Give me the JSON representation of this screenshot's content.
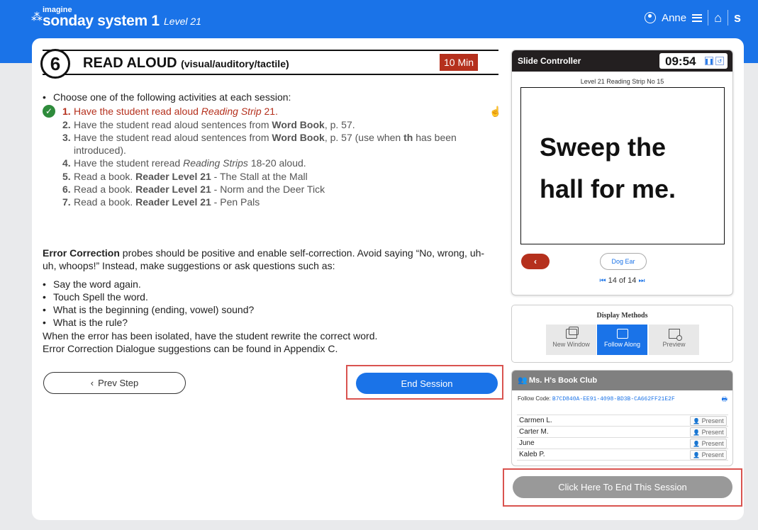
{
  "brand": {
    "imagine": "imagine",
    "name": "sonday system 1",
    "level": "Level 21"
  },
  "header": {
    "user_name": "Anne",
    "s_label": "s"
  },
  "step": {
    "number": "6",
    "title": "READ ALOUD",
    "subtitle": "(visual/auditory/tactile)",
    "duration": "10 Min"
  },
  "instructions": {
    "intro": "Choose one of the following activities at each session:",
    "activities": [
      {
        "num": "1.",
        "html": "Have the student read aloud <i>Reading Strip</i> 21.",
        "active": true
      },
      {
        "num": "2.",
        "html": "Have the student read aloud sentences from <b>Word Book</b>, p. 57.",
        "active": false
      },
      {
        "num": "3.",
        "html": "Have the student read aloud sentences from <b>Word Book</b>, p. 57 (use when <b>th</b> has been introduced).",
        "active": false
      },
      {
        "num": "4.",
        "html": "Have the student reread <i>Reading Strips</i> 18-20 aloud.",
        "active": false
      },
      {
        "num": "5.",
        "html": "Read a book. <b>Reader Level 21</b> - The Stall at the Mall",
        "active": false
      },
      {
        "num": "6.",
        "html": "Read a book. <b>Reader Level 21</b> - Norm and the Deer Tick",
        "active": false
      },
      {
        "num": "7.",
        "html": "Read a book. <b>Reader Level 21</b> - Pen Pals",
        "active": false
      }
    ]
  },
  "error_correction": {
    "lead": "Error Correction",
    "text": " probes should be positive and enable self-correction. Avoid saying “No, wrong, uh-uh, whoops!” Instead, make suggestions or ask questions such as:",
    "suggestions": [
      "Say the word again.",
      "Touch Spell the word.",
      "What is the beginning (ending, vowel) sound?",
      "What is the rule?"
    ],
    "footer1": "When the error has been isolated, have the student rewrite the correct word.",
    "footer2": "Error Correction Dialogue suggestions can be found in Appendix C."
  },
  "buttons": {
    "prev": "Prev Step",
    "end": "End Session",
    "end_this": "Click Here To End This Session"
  },
  "slide_controller": {
    "title": "Slide Controller",
    "timer": "09:54",
    "label": "Level 21 Reading Strip No 15",
    "line1": "Sweep the",
    "line2": "hall for me.",
    "dog_ear": "Dog Ear",
    "pager": "14 of 14"
  },
  "display_methods": {
    "title": "Display Methods",
    "items": [
      {
        "label": "New Window",
        "icon": "new-window-icon",
        "active": false
      },
      {
        "label": "Follow Along",
        "icon": "cast-icon",
        "active": true
      },
      {
        "label": "Preview",
        "icon": "preview-icon",
        "active": false
      }
    ]
  },
  "book_club": {
    "title": "Ms. H's Book Club",
    "follow_label": "Follow Code:",
    "follow_code": "B7CD840A-EE91-4098-BD3B-CA662FF21E2F",
    "students": [
      {
        "name": "Carmen L.",
        "status": "Present"
      },
      {
        "name": "Carter M.",
        "status": "Present"
      },
      {
        "name": "June",
        "status": "Present"
      },
      {
        "name": "Kaleb P.",
        "status": "Present"
      }
    ]
  },
  "colors": {
    "brand_blue": "#1a73e8",
    "accent_red": "#b5301d",
    "success_green": "#2e8b3b",
    "highlight_border": "#d9534f"
  }
}
